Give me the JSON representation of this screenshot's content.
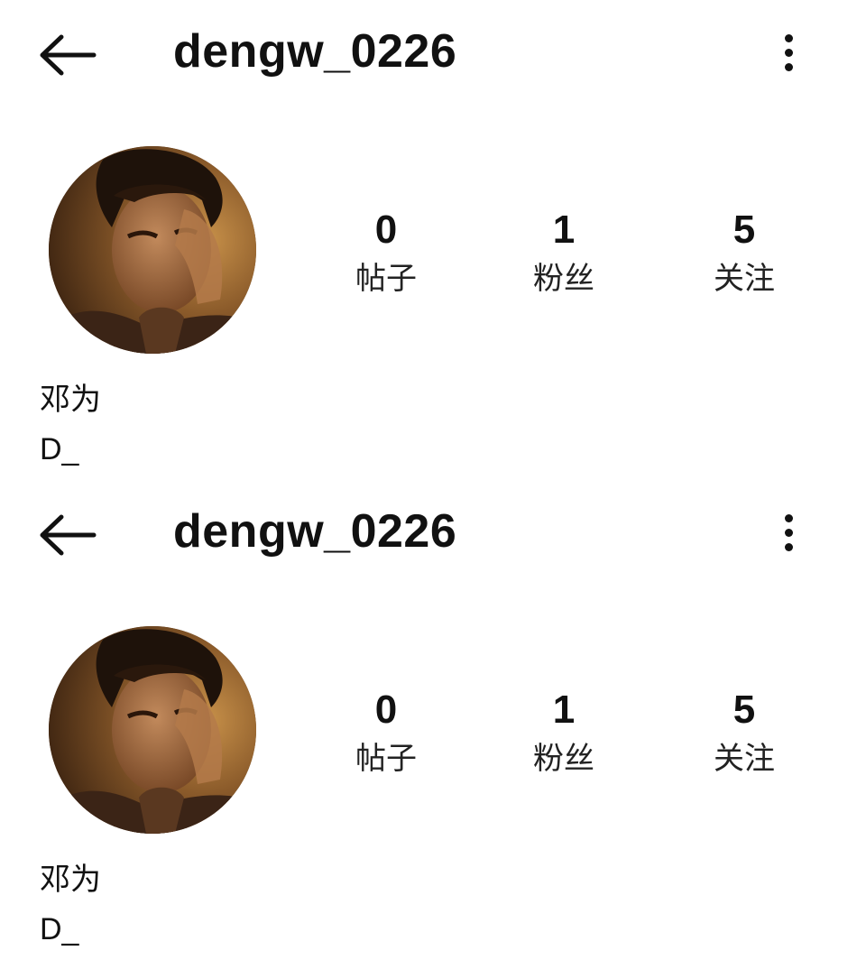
{
  "profiles": [
    {
      "header": {
        "back_icon": "arrow-left-icon",
        "username": "dengw_0226",
        "more_icon": "more-vertical-icon"
      },
      "avatar": {
        "icon": "avatar-photo",
        "tone_color": "#6b4420"
      },
      "stats": [
        {
          "value": "0",
          "label": "帖子"
        },
        {
          "value": "1",
          "label": "粉丝"
        },
        {
          "value": "5",
          "label": "关注"
        }
      ],
      "display_name": "邓为",
      "bio": "D_"
    },
    {
      "header": {
        "back_icon": "arrow-left-icon",
        "username": "dengw_0226",
        "more_icon": "more-vertical-icon"
      },
      "avatar": {
        "icon": "avatar-photo",
        "tone_color": "#6b4420"
      },
      "stats": [
        {
          "value": "0",
          "label": "帖子"
        },
        {
          "value": "1",
          "label": "粉丝"
        },
        {
          "value": "5",
          "label": "关注"
        }
      ],
      "display_name": "邓为",
      "bio": "D_"
    }
  ]
}
